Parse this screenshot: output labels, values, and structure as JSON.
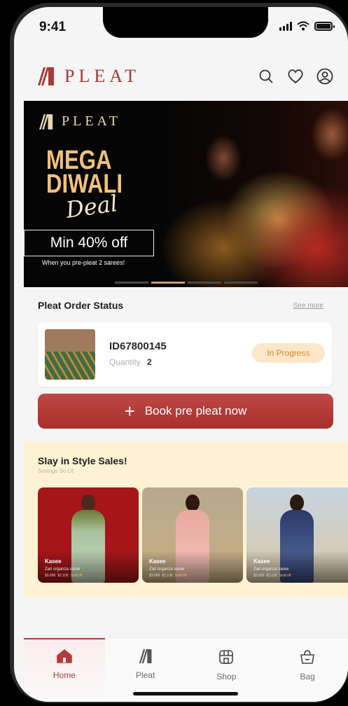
{
  "status_bar": {
    "time": "9:41"
  },
  "header": {
    "brand": "PLEAT",
    "icons": [
      "search-icon",
      "heart-icon",
      "profile-icon"
    ]
  },
  "banner": {
    "brand": "PLEAT",
    "headline_line1": "MEGA",
    "headline_line2": "DIWALI",
    "headline_script": "Deal",
    "offer": "Min 40% off",
    "offer_note": "When you pre-pleat 2 sarees!",
    "slide_count": 4,
    "active_slide": 2
  },
  "order_status": {
    "title": "Pleat Order Status",
    "see_more": "See more",
    "order": {
      "id": "ID67800145",
      "quantity_label": "Quantity",
      "quantity": "2",
      "status": "In Progress"
    }
  },
  "book_button": {
    "label": "Book pre pleat now"
  },
  "sales": {
    "title": "Slay in Style Sales!",
    "subtitle": "Savings So Lit",
    "products": [
      {
        "name": "Kasee",
        "desc": "Zari organza saree",
        "price": "$3,600",
        "sale_price": "$2,100",
        "discount": "Sold off"
      },
      {
        "name": "Kasee",
        "desc": "Zari organza saree",
        "price": "$3,600",
        "sale_price": "$2,100",
        "discount": "Sold off"
      },
      {
        "name": "Kasee",
        "desc": "Zari organza saree",
        "price": "$3,600",
        "sale_price": "$2,100",
        "discount": "Sold off"
      }
    ]
  },
  "bottom_nav": {
    "items": [
      {
        "label": "Home",
        "icon": "home-icon",
        "active": true
      },
      {
        "label": "Pleat",
        "icon": "pleat-logo-icon",
        "active": false
      },
      {
        "label": "Shop",
        "icon": "shop-icon",
        "active": false
      },
      {
        "label": "Bag",
        "icon": "bag-icon",
        "active": false
      }
    ]
  },
  "colors": {
    "brand_red": "#a93a37",
    "banner_gold": "#f1c27b",
    "progress_bg": "#fde7c9",
    "progress_text": "#d9892b",
    "sales_bg": "#fdf3d3"
  }
}
